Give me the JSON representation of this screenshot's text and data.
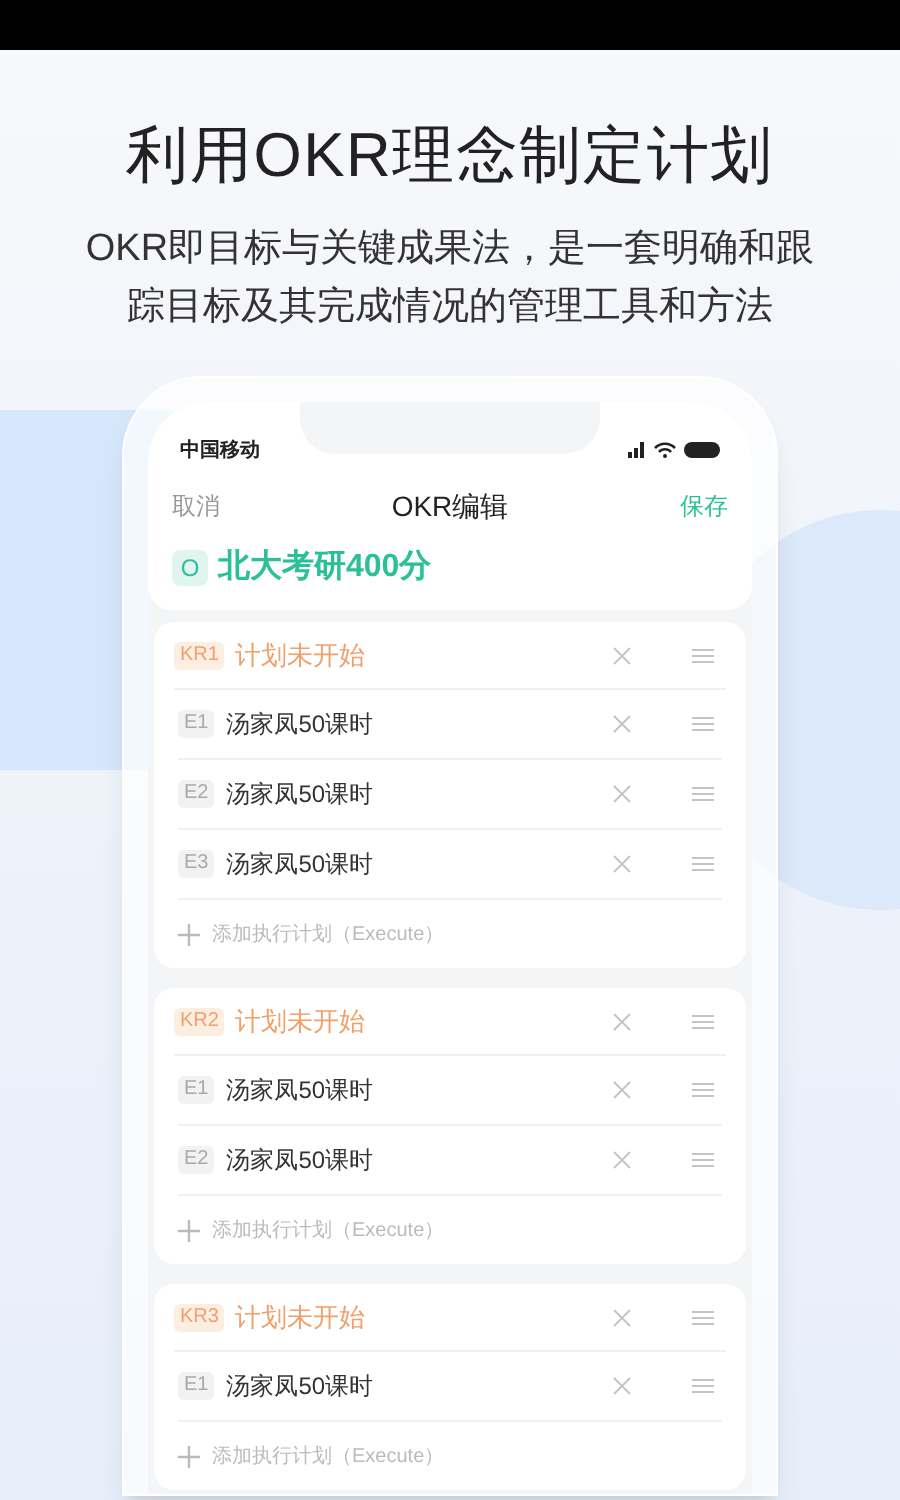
{
  "headline": "利用OKR理念制定计划",
  "subtitle": "OKR即目标与关键成果法，是一套明确和跟踪目标及其完成情况的管理工具和方法",
  "phone": {
    "carrier": "中国移动",
    "nav": {
      "cancel": "取消",
      "title": "OKR编辑",
      "save": "保存"
    },
    "objective": {
      "badge": "O",
      "text": "北大考研400分"
    },
    "key_results": [
      {
        "badge": "KR1",
        "title": "计划未开始",
        "executes": [
          {
            "badge": "E1",
            "text": "汤家凤50课时"
          },
          {
            "badge": "E2",
            "text": "汤家凤50课时"
          },
          {
            "badge": "E3",
            "text": "汤家凤50课时"
          }
        ],
        "add": "添加执行计划（Execute）"
      },
      {
        "badge": "KR2",
        "title": "计划未开始",
        "executes": [
          {
            "badge": "E1",
            "text": "汤家凤50课时"
          },
          {
            "badge": "E2",
            "text": "汤家凤50课时"
          }
        ],
        "add": "添加执行计划（Execute）"
      },
      {
        "badge": "KR3",
        "title": "计划未开始",
        "executes": [
          {
            "badge": "E1",
            "text": "汤家凤50课时"
          }
        ],
        "add": "添加执行计划（Execute）"
      }
    ]
  }
}
